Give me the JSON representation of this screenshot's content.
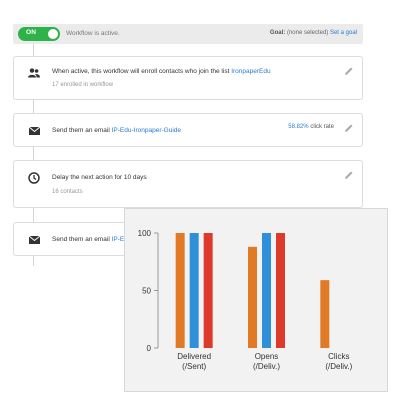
{
  "status": {
    "toggle_label": "ON",
    "text": "Workflow is active.",
    "goal_label": "Goal:",
    "goal_value": "(none selected)",
    "goal_link": "Set a goal"
  },
  "steps": [
    {
      "icon": "contacts-icon",
      "text": "When active, this workflow will enroll contacts who join the list",
      "link": "IronpaperEdu",
      "sub": "17 enrolled in workflow"
    },
    {
      "icon": "email-icon",
      "text": "Send them an email",
      "link": "IP-Edu-Ironpaper-Guide",
      "metric_pct": "58.82%",
      "metric_label": "click rate"
    },
    {
      "icon": "clock-icon",
      "text": "Delay the next action for 10 days",
      "sub": "16 contacts"
    },
    {
      "icon": "email-icon",
      "text": "Send them an email",
      "link": "IP-Ed"
    }
  ],
  "colors": {
    "orange": "#e07a26",
    "blue": "#2f8fd8",
    "red": "#dd3a2c",
    "toggle_green": "#2eb34b",
    "link_blue": "#2a7ad5"
  },
  "chart_data": {
    "type": "bar",
    "categories": [
      "Delivered\n(/Sent)",
      "Opens\n(/Deliv.)",
      "Clicks\n(/Deliv.)"
    ],
    "series": [
      {
        "values": [
          100,
          88,
          59
        ],
        "color": "#e07a26"
      },
      {
        "values": [
          100,
          100,
          null
        ],
        "color": "#2f8fd8"
      },
      {
        "values": [
          100,
          100,
          null
        ],
        "color": "#dd3a2c"
      }
    ],
    "yticks": [
      "0",
      "50",
      "100"
    ],
    "ylim": [
      0,
      100
    ],
    "grid": false
  }
}
